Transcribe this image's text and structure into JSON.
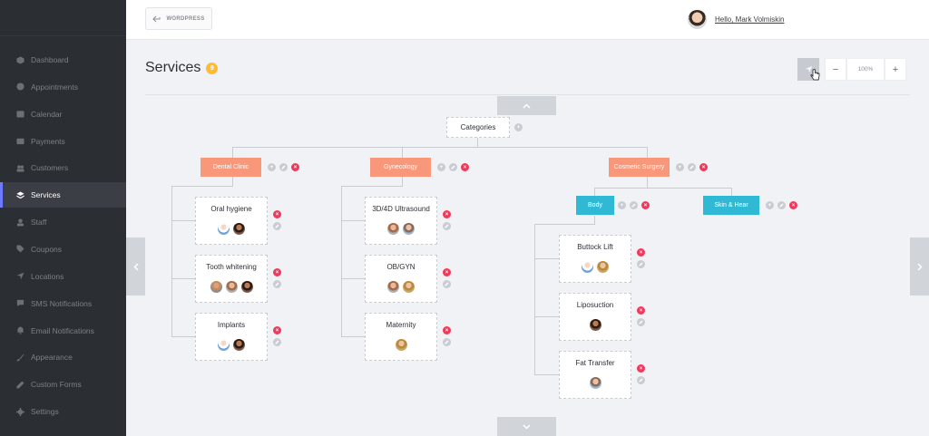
{
  "header": {
    "wordpress_label": "WORDPRESS",
    "greeting": "Hello, Mark Volmiskin"
  },
  "sidebar": {
    "items": [
      {
        "label": "Dashboard",
        "icon": "cube-icon"
      },
      {
        "label": "Appointments",
        "icon": "clock-icon"
      },
      {
        "label": "Calendar",
        "icon": "calendar-icon"
      },
      {
        "label": "Payments",
        "icon": "wallet-icon"
      },
      {
        "label": "Customers",
        "icon": "users-icon"
      },
      {
        "label": "Services",
        "icon": "layers-icon",
        "active": true
      },
      {
        "label": "Staff",
        "icon": "user-icon"
      },
      {
        "label": "Coupons",
        "icon": "tag-icon"
      },
      {
        "label": "Locations",
        "icon": "location-arrow-icon"
      },
      {
        "label": "SMS Notifications",
        "icon": "chat-icon"
      },
      {
        "label": "Email Notifications",
        "icon": "bell-icon"
      },
      {
        "label": "Appearance",
        "icon": "brush-icon"
      },
      {
        "label": "Custom Forms",
        "icon": "pen-icon"
      },
      {
        "label": "Settings",
        "icon": "gear-icon"
      }
    ]
  },
  "page": {
    "title": "Services",
    "count": "9",
    "zoom": "100%",
    "zoom_out": "−",
    "zoom_in": "+"
  },
  "tree": {
    "root": "Categories",
    "categories": [
      {
        "label": "Dental Clinic"
      },
      {
        "label": "Gynecology"
      },
      {
        "label": "Cosmetic Surgery"
      }
    ],
    "subcategories": [
      {
        "label": "Body"
      },
      {
        "label": "Skin & Hear"
      }
    ],
    "services": [
      {
        "name": "Oral hygiene"
      },
      {
        "name": "Tooth whitening"
      },
      {
        "name": "Implants"
      },
      {
        "name": "3D/4D Ultrasound"
      },
      {
        "name": "OB/GYN"
      },
      {
        "name": "Maternity"
      },
      {
        "name": "Buttock Lift"
      },
      {
        "name": "Liposuction"
      },
      {
        "name": "Fat Transfer"
      }
    ]
  },
  "colors": {
    "category": "#f9977b",
    "subcategory": "#2fb9d4",
    "delete": "#f2385a",
    "badge": "#ffbb33",
    "active_accent": "#6c7bff"
  }
}
